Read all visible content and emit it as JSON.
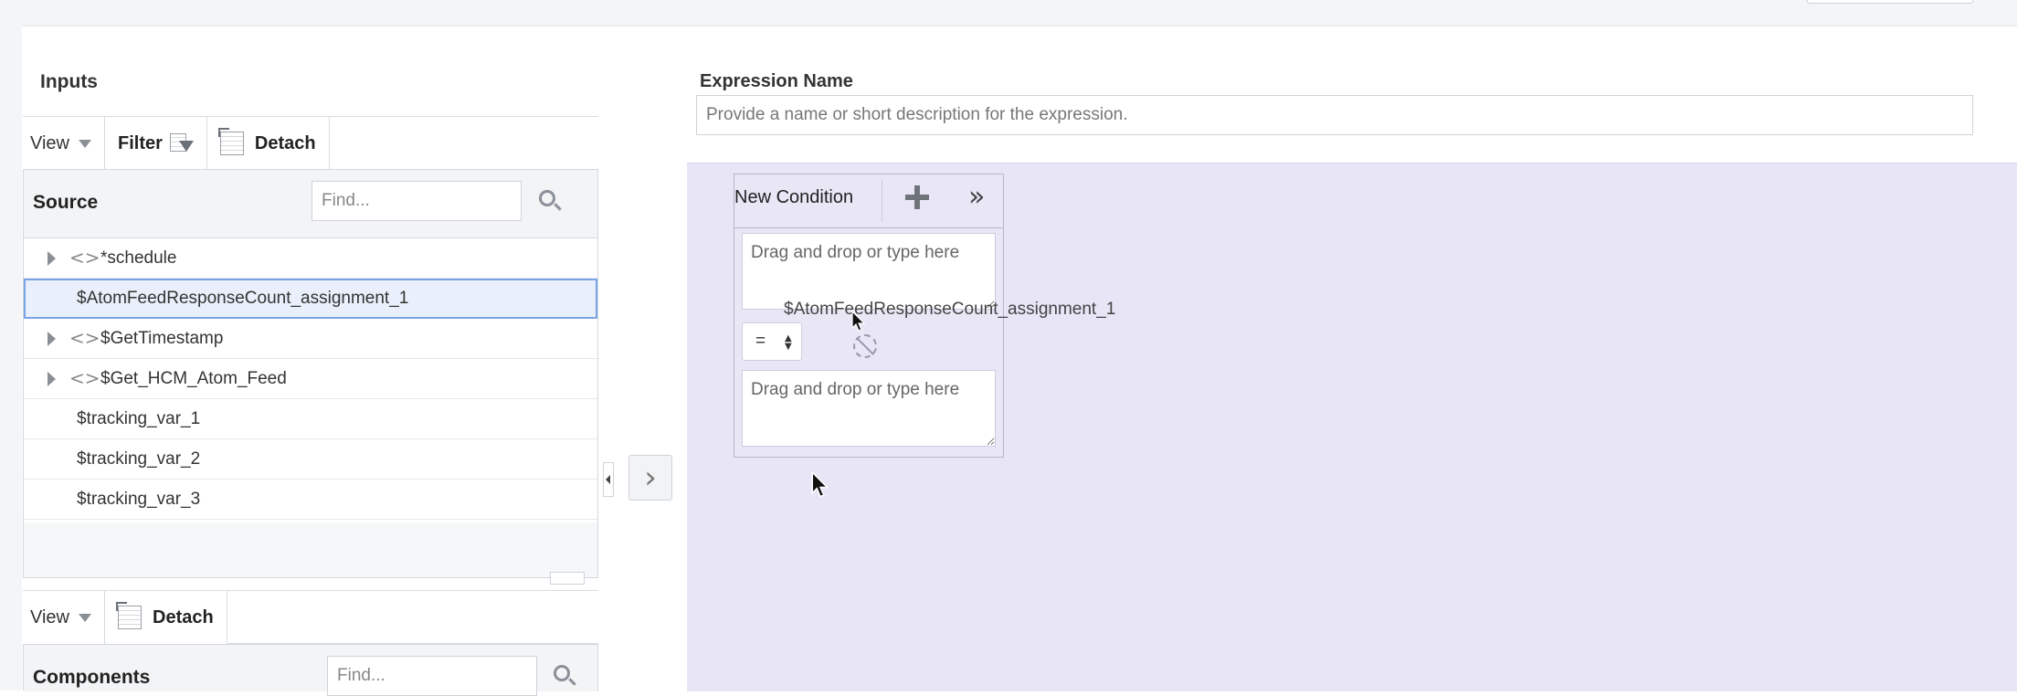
{
  "inputs_panel": {
    "title": "Inputs",
    "toolbar": {
      "view_label": "View",
      "filter_label": "Filter",
      "detach_label": "Detach"
    },
    "source": {
      "title": "Source",
      "find_placeholder": "Find...",
      "items": [
        {
          "label": "*schedule",
          "expandable": true
        },
        {
          "label": "$AtomFeedResponseCount_assignment_1",
          "selected": true
        },
        {
          "label": "$GetTimestamp",
          "expandable": true
        },
        {
          "label": "$Get_HCM_Atom_Feed",
          "expandable": true
        },
        {
          "label": "$tracking_var_1"
        },
        {
          "label": "$tracking_var_2"
        },
        {
          "label": "$tracking_var_3"
        }
      ]
    },
    "components_toolbar": {
      "view_label": "View",
      "detach_label": "Detach"
    },
    "components": {
      "title": "Components",
      "find_placeholder": "Find..."
    }
  },
  "expression": {
    "name_label": "Expression Name",
    "name_placeholder": "Provide a name or short description for the expression."
  },
  "condition": {
    "title": "New Condition",
    "left_placeholder": "Drag and drop or type here",
    "operator": "=",
    "right_placeholder": "Drag and drop or type here",
    "drag_ghost_text": "$AtomFeedResponseCount_assignment_1"
  },
  "colors": {
    "canvas_bg": "#e8e5f6",
    "selection_border": "#7aa4e6",
    "selection_bg": "#e9f0fb"
  }
}
